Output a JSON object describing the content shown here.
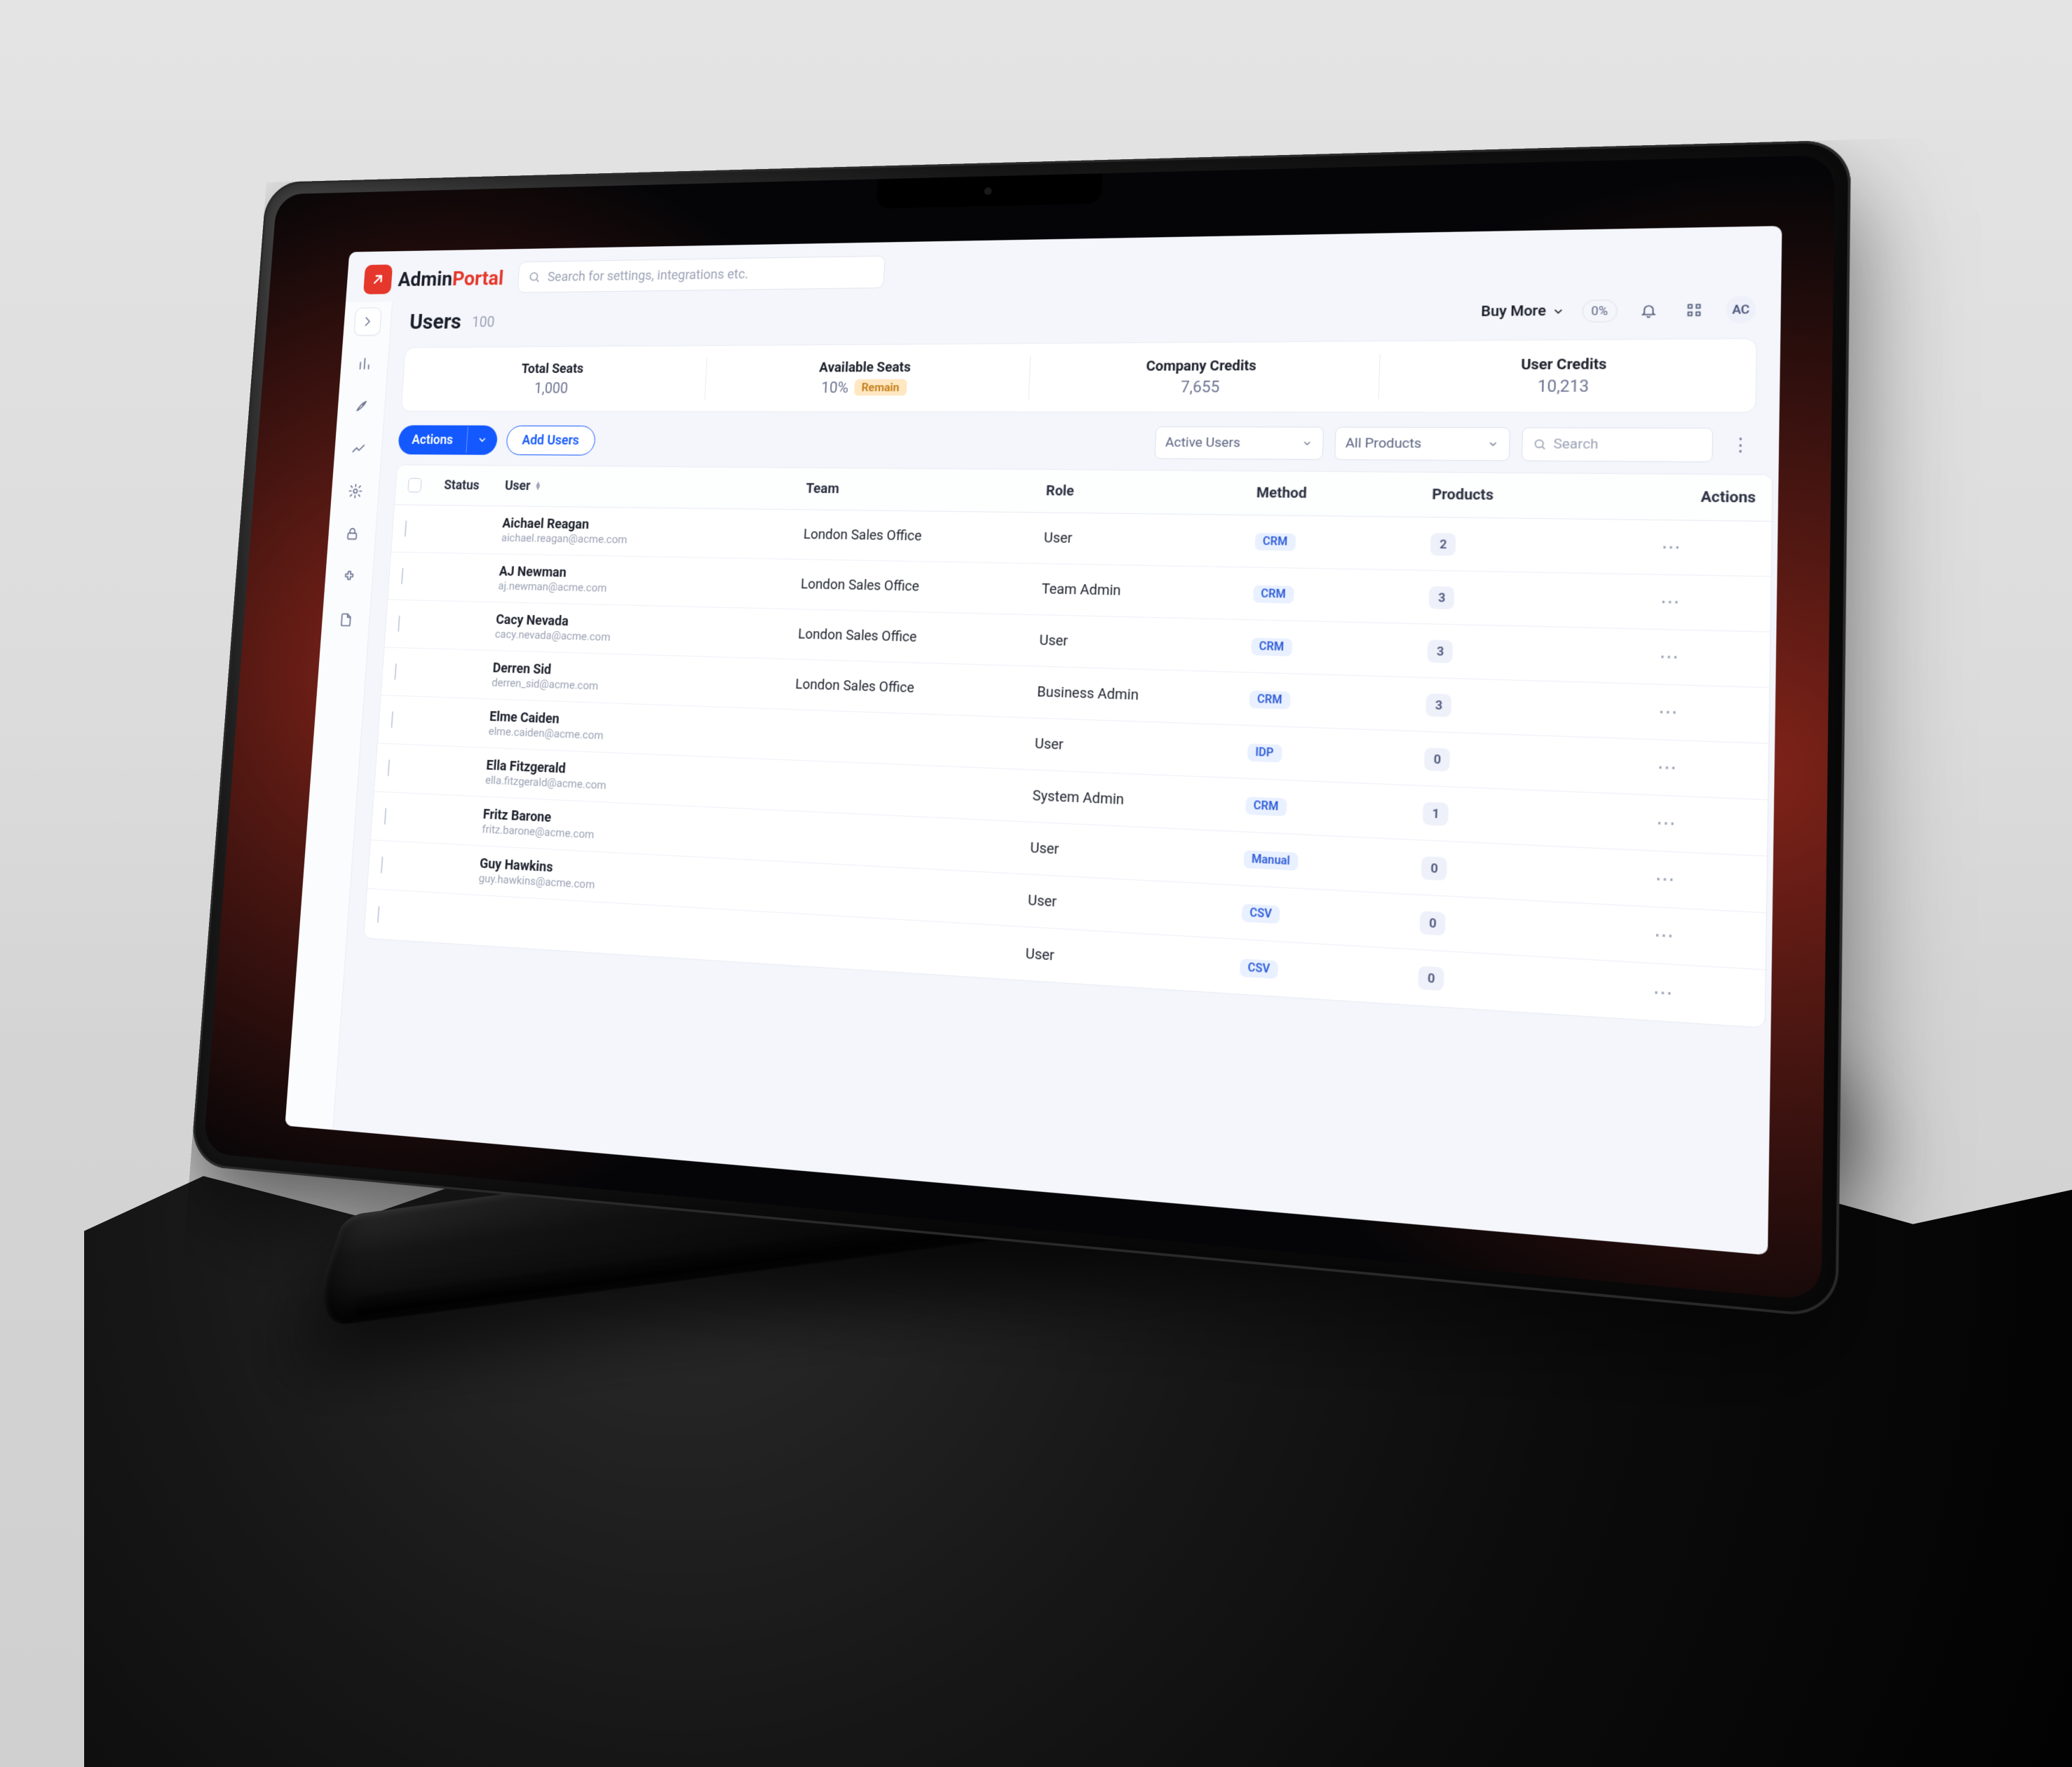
{
  "brand": {
    "part1": "Admin",
    "part2": "Portal"
  },
  "search_placeholder": "Search for settings, integrations etc.",
  "page": {
    "title": "Users",
    "count": "100"
  },
  "header_right": {
    "buy_more": "Buy More",
    "pct_badge": "0%",
    "avatar_initials": "AC"
  },
  "stats": {
    "total_seats": {
      "label": "Total Seats",
      "value": "1,000"
    },
    "available_seats": {
      "label": "Available Seats",
      "pct": "10%",
      "chip": "Remain"
    },
    "company_credits": {
      "label": "Company Credits",
      "value": "7,655"
    },
    "user_credits": {
      "label": "User Credits",
      "value": "10,213"
    }
  },
  "toolbar": {
    "actions_label": "Actions",
    "add_users_label": "Add Users",
    "filter_status": "Active Users",
    "filter_products": "All Products",
    "search_placeholder": "Search"
  },
  "table": {
    "headers": {
      "status": "Status",
      "user": "User",
      "team": "Team",
      "role": "Role",
      "method": "Method",
      "products": "Products",
      "actions": "Actions"
    },
    "rows": [
      {
        "status": "orange",
        "name": "Aichael Reagan",
        "email": "aichael.reagan@acme.com",
        "team": "London Sales Office",
        "role": "User",
        "method": "CRM",
        "products": "2"
      },
      {
        "status": "grey",
        "name": "AJ Newman",
        "email": "aj.newman@acme.com",
        "team": "London Sales Office",
        "role": "Team Admin",
        "method": "CRM",
        "products": "3"
      },
      {
        "status": "orange",
        "name": "Cacy Nevada",
        "email": "cacy.nevada@acme.com",
        "team": "London Sales Office",
        "role": "User",
        "method": "CRM",
        "products": "3"
      },
      {
        "status": "grey",
        "name": "Derren Sid",
        "email": "derren_sid@acme.com",
        "team": "London Sales Office",
        "role": "Business Admin",
        "method": "CRM",
        "products": "3"
      },
      {
        "status": "grey",
        "name": "Elme Caiden",
        "email": "elme.caiden@acme.com",
        "team": "",
        "role": "User",
        "method": "IDP",
        "products": "0"
      },
      {
        "status": "grey",
        "name": "Ella Fitzgerald",
        "email": "ella.fitzgerald@acme.com",
        "team": "",
        "role": "System Admin",
        "method": "CRM",
        "products": "1"
      },
      {
        "status": "grey",
        "name": "Fritz Barone",
        "email": "fritz.barone@acme.com",
        "team": "",
        "role": "User",
        "method": "Manual",
        "products": "0"
      },
      {
        "status": "grey",
        "name": "Guy Hawkins",
        "email": "guy.hawkins@acme.com",
        "team": "",
        "role": "User",
        "method": "CSV",
        "products": "0"
      },
      {
        "status": "grey",
        "name": "",
        "email": "",
        "team": "",
        "role": "User",
        "method": "CSV",
        "products": "0"
      }
    ]
  }
}
